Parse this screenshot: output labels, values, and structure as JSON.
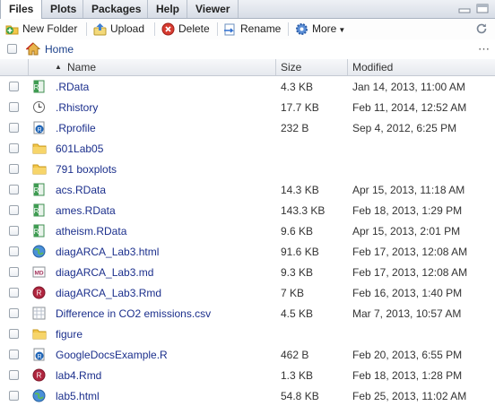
{
  "tabs": [
    {
      "label": "Files",
      "active": true
    },
    {
      "label": "Plots"
    },
    {
      "label": "Packages"
    },
    {
      "label": "Help"
    },
    {
      "label": "Viewer"
    }
  ],
  "toolbar": {
    "new_folder": "New Folder",
    "upload": "Upload",
    "delete": "Delete",
    "rename": "Rename",
    "more": "More"
  },
  "breadcrumb": {
    "home": "Home"
  },
  "columns": {
    "name": "Name",
    "size": "Size",
    "modified": "Modified",
    "sort_arrow": "▲"
  },
  "files": [
    {
      "name": ".RData",
      "size": "4.3 KB",
      "modified": "Jan 14, 2013, 11:00 AM",
      "icon": "rdata-icon"
    },
    {
      "name": ".Rhistory",
      "size": "17.7 KB",
      "modified": "Feb 11, 2014, 12:52 AM",
      "icon": "history-icon"
    },
    {
      "name": ".Rprofile",
      "size": "232 B",
      "modified": "Sep 4, 2012, 6:25 PM",
      "icon": "r-script-icon"
    },
    {
      "name": "601Lab05",
      "size": "",
      "modified": "",
      "icon": "folder-icon"
    },
    {
      "name": "791 boxplots",
      "size": "",
      "modified": "",
      "icon": "folder-icon"
    },
    {
      "name": "acs.RData",
      "size": "14.3 KB",
      "modified": "Apr 15, 2013, 11:18 AM",
      "icon": "rdata-icon"
    },
    {
      "name": "ames.RData",
      "size": "143.3 KB",
      "modified": "Feb 18, 2013, 1:29 PM",
      "icon": "rdata-icon"
    },
    {
      "name": "atheism.RData",
      "size": "9.6 KB",
      "modified": "Apr 15, 2013, 2:01 PM",
      "icon": "rdata-icon"
    },
    {
      "name": "diagARCA_Lab3.html",
      "size": "91.6 KB",
      "modified": "Feb 17, 2013, 12:08 AM",
      "icon": "html-icon"
    },
    {
      "name": "diagARCA_Lab3.md",
      "size": "9.3 KB",
      "modified": "Feb 17, 2013, 12:08 AM",
      "icon": "md-icon"
    },
    {
      "name": "diagARCA_Lab3.Rmd",
      "size": "7 KB",
      "modified": "Feb 16, 2013, 1:40 PM",
      "icon": "rmd-icon"
    },
    {
      "name": "Difference in CO2 emissions.csv",
      "size": "4.5 KB",
      "modified": "Mar 7, 2013, 10:57 AM",
      "icon": "csv-icon"
    },
    {
      "name": "figure",
      "size": "",
      "modified": "",
      "icon": "folder-icon"
    },
    {
      "name": "GoogleDocsExample.R",
      "size": "462 B",
      "modified": "Feb 20, 2013, 6:55 PM",
      "icon": "r-script-icon"
    },
    {
      "name": "lab4.Rmd",
      "size": "1.3 KB",
      "modified": "Feb 18, 2013, 1:28 PM",
      "icon": "rmd-icon"
    },
    {
      "name": "lab5.html",
      "size": "54.8 KB",
      "modified": "Feb 25, 2013, 11:02 AM",
      "icon": "html-icon"
    }
  ],
  "colors": {
    "link": "#1b2f8c",
    "tab_bg": "#d7dde6",
    "folder": "#f3c64a"
  }
}
